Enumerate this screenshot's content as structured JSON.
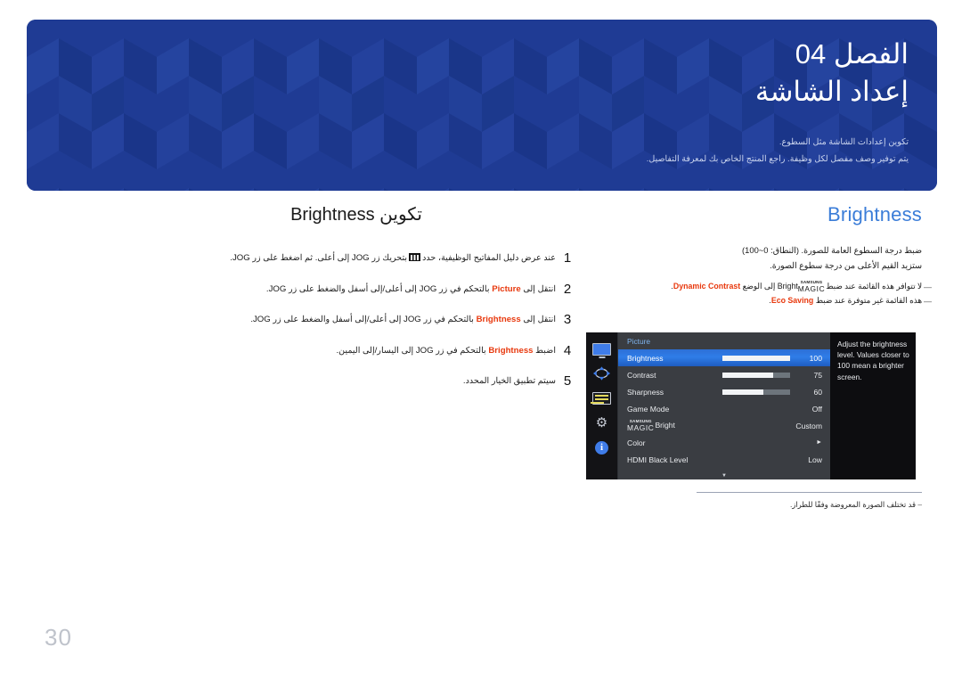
{
  "banner": {
    "chapter_label": "الفصل 04",
    "chapter_title": "إعداد الشاشة",
    "subtitle_line1": "تكوين إعدادات الشاشة مثل السطوع.",
    "subtitle_line2": "يتم توفير وصف مفصل لكل وظيفة. راجع المنتج الخاص بك لمعرفة التفاصيل.",
    "bg_color": "#1f3b94",
    "title_color": "#ffffff",
    "subtitle_color": "#ccd6ef"
  },
  "left": {
    "heading": "تكوين Brightness",
    "steps": [
      {
        "num": "1",
        "pre": "عند عرض دليل المفاتيح الوظيفية، حدد",
        "icon": "menu-bars-glyph",
        "post": "بتحريك زر JOG إلى أعلى. ثم اضغط على زر JOG."
      },
      {
        "num": "2",
        "pre": "انتقل إلى",
        "keyword": "Picture",
        "post": "بالتحكم في زر JOG إلى أعلى/إلى أسفل والضغط على زر JOG."
      },
      {
        "num": "3",
        "pre": "انتقل إلى",
        "keyword": "Brightness",
        "post": "بالتحكم في زر JOG إلى أعلى/إلى أسفل والضغط على زر JOG."
      },
      {
        "num": "4",
        "pre": "اضبط",
        "keyword": "Brightness",
        "post": "بالتحكم في زر JOG إلى اليسار/إلى اليمين."
      },
      {
        "num": "5",
        "pre": "سيتم تطبيق الخيار المحدد.",
        "keyword": "",
        "post": ""
      }
    ]
  },
  "right": {
    "title": "Brightness",
    "title_color": "#3b7dd8",
    "description_line1": "ضبط درجة السطوع العامة للصورة. (النطاق: 0~100)",
    "description_line2": "ستزيد القيم الأعلى من درجة سطوع الصورة.",
    "notes": [
      {
        "dash": "―",
        "pre": "لا تتوافر هذه القائمة عند ضبط",
        "magic_top": "SAMSUNG",
        "magic_bottom": "MAGIC",
        "magic_suffix": "Bright",
        "mid": "إلى الوضع",
        "keyword": "Dynamic Contrast",
        "post": "."
      },
      {
        "dash": "―",
        "pre": "هذه القائمة غير متوفرة عند ضبط",
        "keyword": "Eco Saving",
        "post": "."
      }
    ]
  },
  "osd": {
    "category": "Picture",
    "rail_icons": [
      "monitor-icon",
      "move-arrows-icon",
      "osd-list-icon",
      "gear-icon",
      "info-icon"
    ],
    "rows": [
      {
        "label": "Brightness",
        "type": "slider",
        "value": "100",
        "fill_pct": 100,
        "active": true
      },
      {
        "label": "Contrast",
        "type": "slider",
        "value": "75",
        "fill_pct": 75,
        "active": false
      },
      {
        "label": "Sharpness",
        "type": "slider",
        "value": "60",
        "fill_pct": 60,
        "active": false
      },
      {
        "label": "Game Mode",
        "type": "value",
        "value": "Off",
        "active": false
      },
      {
        "label": "MAGICBright",
        "type": "magic",
        "value": "Custom",
        "magic_top": "SAMSUNG",
        "magic_bottom": "MAGIC",
        "magic_suffix": "Bright",
        "active": false
      },
      {
        "label": "Color",
        "type": "submenu",
        "value": "►",
        "active": false
      },
      {
        "label": "HDMI Black Level",
        "type": "value",
        "value": "Low",
        "active": false
      }
    ],
    "scroll_down_glyph": "▼",
    "help_text": "Adjust the brightness level. Values closer to 100 mean a brighter screen.",
    "highlight_color": "#2f7de8",
    "panel_bg": "#3a3d42",
    "rail_bg": "#131316"
  },
  "footer": {
    "note_dash": "–",
    "note_text": "قد تختلف الصورة المعروضة وفقًا للطراز.",
    "page_number": "30"
  }
}
